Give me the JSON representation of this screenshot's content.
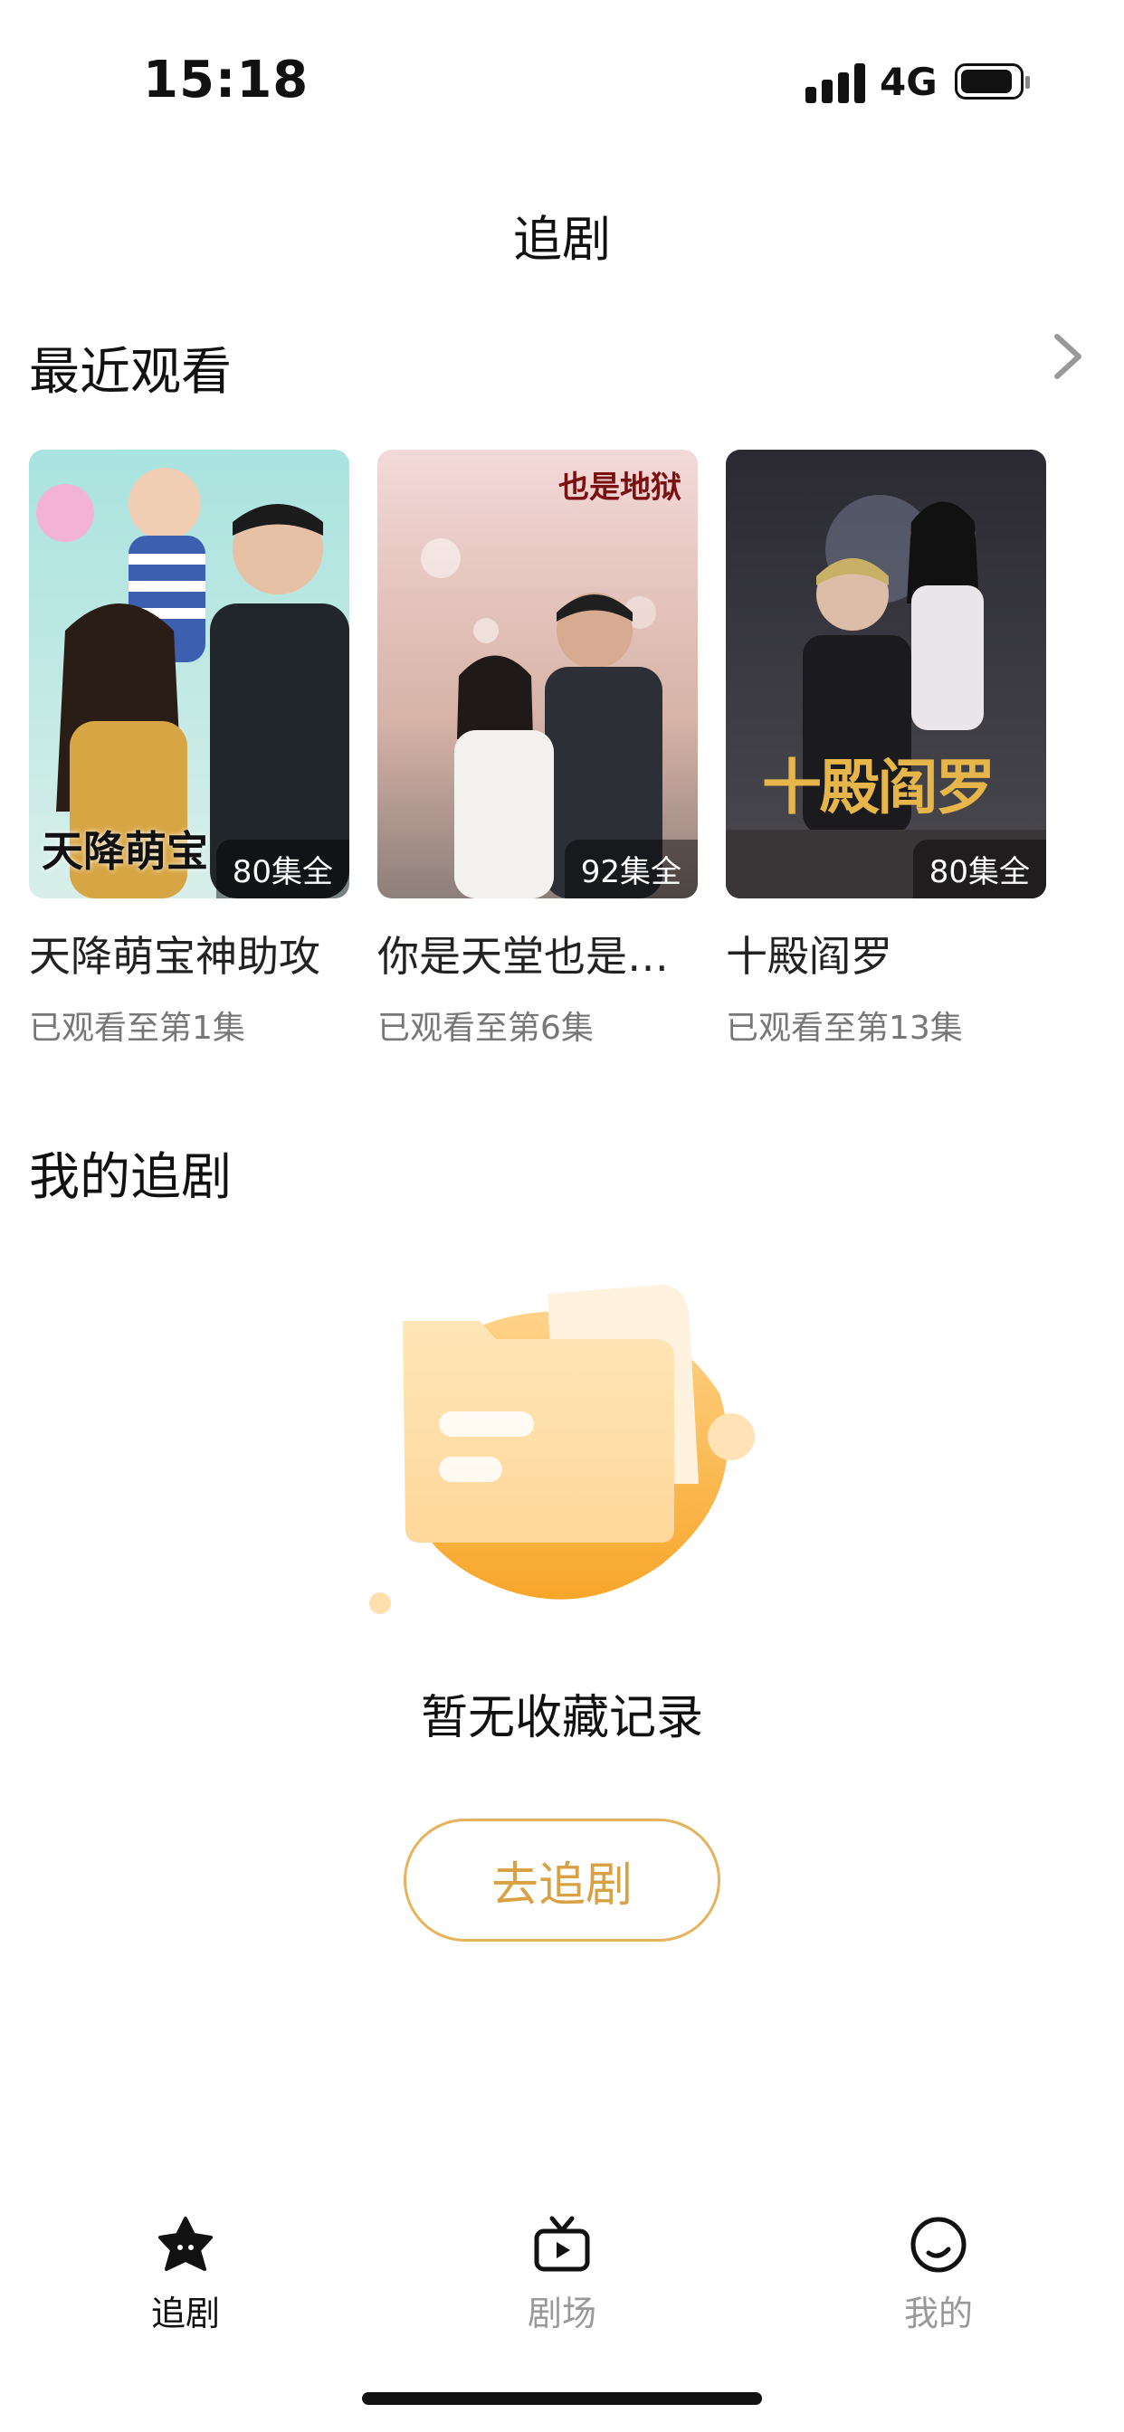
{
  "status_bar": {
    "time": "15:18",
    "network": "4G"
  },
  "page_title": "追剧",
  "recent": {
    "title": "最近观看",
    "items": [
      {
        "title": "天降萌宝神助攻",
        "episodes": "80集全",
        "progress": "已观看至第1集",
        "poster_text": "天降萌宝"
      },
      {
        "title": "你是天堂也是地狱",
        "episodes": "92集全",
        "progress": "已观看至第6集",
        "poster_text": "也是地狱"
      },
      {
        "title": "十殿阎罗",
        "episodes": "80集全",
        "progress": "已观看至第13集",
        "poster_text": "十殿阎罗"
      }
    ]
  },
  "mine": {
    "title": "我的追剧",
    "empty_text": "暂无收藏记录",
    "button_label": "去追剧"
  },
  "tabs": [
    {
      "label": "追剧",
      "icon": "star-face-icon",
      "active": true
    },
    {
      "label": "剧场",
      "icon": "tv-play-icon",
      "active": false
    },
    {
      "label": "我的",
      "icon": "smile-circle-icon",
      "active": false
    }
  ],
  "colors": {
    "accent": "#f5a623",
    "button_border": "#e6b25c",
    "button_text": "#d8a144"
  }
}
